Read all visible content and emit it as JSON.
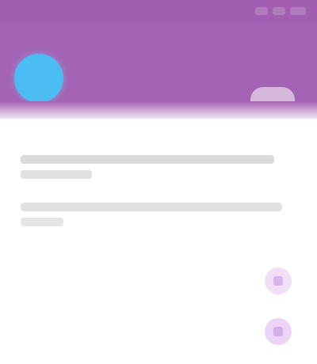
{
  "header": {
    "background_color": "#a463b4",
    "avatar_color": "#4bbdf2",
    "user_name": "",
    "user_subtitle": "",
    "action_icon": "menu-tab-icon"
  },
  "content": {
    "section_label": "",
    "rows": [
      {
        "label": "",
        "action_icon": "chevron-icon"
      },
      {
        "label": "",
        "action_icon": "chevron-icon"
      }
    ]
  }
}
